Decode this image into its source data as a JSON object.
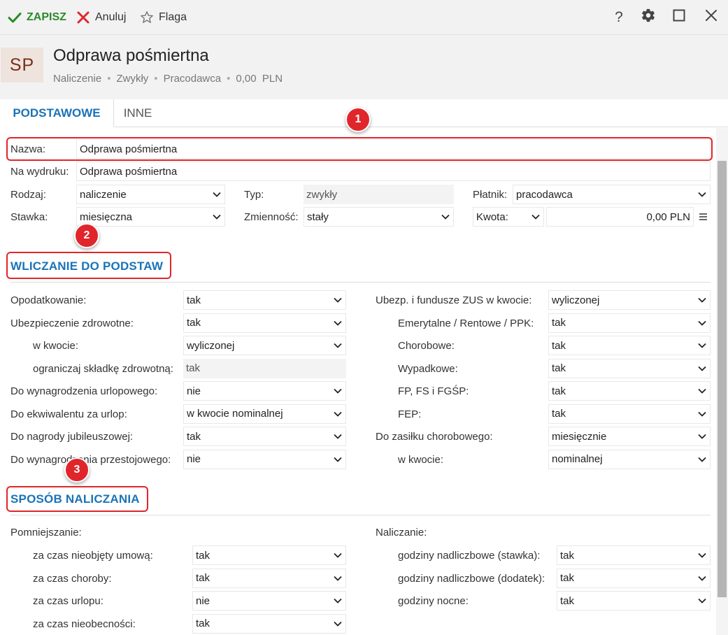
{
  "toolbar": {
    "save_label": "ZAPISZ",
    "cancel_label": "Anuluj",
    "flag_label": "Flaga",
    "help_glyph": "?"
  },
  "header": {
    "avatar_text": "SP",
    "title": "Odprawa pośmiertna",
    "subtitle": [
      "Naliczenie",
      "Zwykły",
      "Pracodawca",
      "0,00  PLN"
    ]
  },
  "tabs": [
    {
      "label": "PODSTAWOWE",
      "active": true
    },
    {
      "label": "INNE",
      "active": false
    }
  ],
  "basic": {
    "nazwa_label": "Nazwa:",
    "nazwa_value": "Odprawa pośmiertna",
    "wydruk_label": "Na wydruku:",
    "wydruk_value": "Odprawa pośmiertna",
    "rodzaj_label": "Rodzaj:",
    "rodzaj_value": "naliczenie",
    "typ_label": "Typ:",
    "typ_value": "zwykły",
    "platnik_label": "Płatnik:",
    "platnik_value": "pracodawca",
    "stawka_label": "Stawka:",
    "stawka_value": "miesięczna",
    "zmiennosc_label": "Zmienność:",
    "zmiennosc_value": "stały",
    "kwota_label": "Kwota:",
    "kwota_value": "0,00 PLN"
  },
  "section1": {
    "title": "WLICZANIE DO PODSTAW",
    "left": [
      {
        "label": "Opodatkowanie:",
        "value": "tak"
      },
      {
        "label": "Ubezpieczenie zdrowotne:",
        "value": "tak"
      },
      {
        "label": "w kwocie:",
        "value": "wyliczonej"
      },
      {
        "label": "ograniczaj składkę zdrowotną:",
        "value": "tak"
      },
      {
        "label": "Do wynagrodzenia urlopowego:",
        "value": "nie"
      },
      {
        "label": "Do ekwiwalentu za urlop:",
        "value": "w kwocie nominalnej"
      },
      {
        "label": "Do nagrody jubileuszowej:",
        "value": "tak"
      },
      {
        "label": "Do wynagrodzenia przestojowego:",
        "value": "nie"
      }
    ],
    "right": [
      {
        "label": "Ubezp. i fundusze ZUS w kwocie:",
        "value": "wyliczonej"
      },
      {
        "label": "Emerytalne / Rentowe / PPK:",
        "value": "tak"
      },
      {
        "label": "Chorobowe:",
        "value": "tak"
      },
      {
        "label": "Wypadkowe:",
        "value": "tak"
      },
      {
        "label": "FP, FS i FGŚP:",
        "value": "tak"
      },
      {
        "label": "FEP:",
        "value": "tak"
      },
      {
        "label": "Do zasiłku chorobowego:",
        "value": "miesięcznie"
      },
      {
        "label": "w kwocie:",
        "value": "nominalnej"
      }
    ]
  },
  "section2": {
    "title": "SPOSÓB NALICZANIA",
    "left_title": "Pomniejszanie:",
    "right_title": "Naliczanie:",
    "left": [
      {
        "label": "za czas nieobjęty umową:",
        "value": "tak"
      },
      {
        "label": "za czas choroby:",
        "value": "tak"
      },
      {
        "label": "za czas urlopu:",
        "value": "nie"
      },
      {
        "label": "za czas nieobecności:",
        "value": "tak"
      }
    ],
    "right": [
      {
        "label": "godziny nadliczbowe (stawka):",
        "value": "tak"
      },
      {
        "label": "godziny nadliczbowe (dodatek):",
        "value": "tak"
      },
      {
        "label": "godziny nocne:",
        "value": "tak"
      }
    ]
  },
  "badges": [
    "1",
    "2",
    "3"
  ],
  "colors": {
    "accent": "#1a73b8",
    "save_green": "#2a8a2a",
    "cancel_red": "#e0262b",
    "highlight_red": "#e0262b",
    "avatar_text": "#7a2d18",
    "avatar_bg": "#efe3de"
  },
  "icons": {
    "save": "check-icon",
    "cancel": "x-icon",
    "flag": "star-icon",
    "help": "question-icon",
    "settings": "gear-icon",
    "maximize": "maximize-icon",
    "close": "close-icon",
    "dropdown": "chevron-down-icon",
    "menu": "hamburger-icon"
  }
}
